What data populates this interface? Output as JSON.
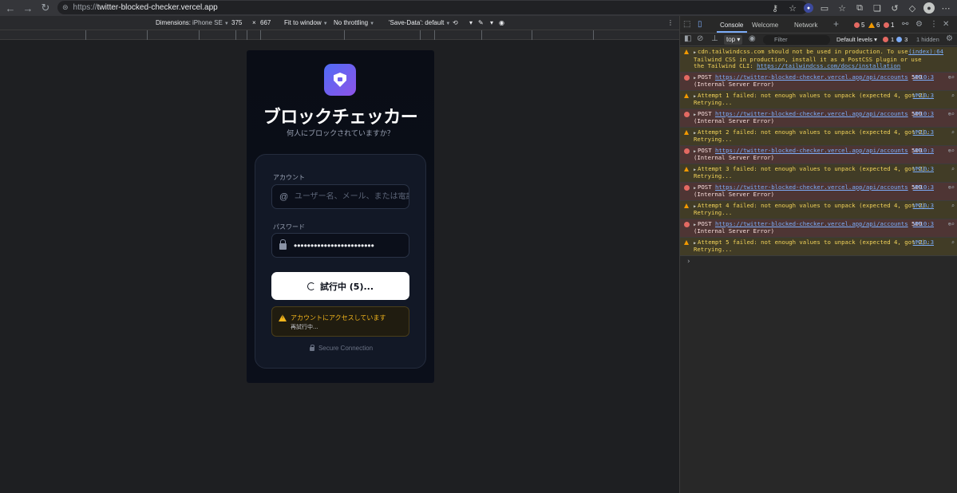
{
  "browser": {
    "url_protocol": "https://",
    "url_host": "twitter-blocked-checker.vercel.app"
  },
  "device_toolbar": {
    "dimensions_label": "Dimensions:",
    "device": "iPhone SE",
    "width": "375",
    "times": "×",
    "height": "667",
    "zoom": "Fit to window",
    "throttling": "No throttling",
    "save_data": "'Save-Data': default"
  },
  "app": {
    "title": "ブロックチェッカー",
    "subtitle": "何人にブロックされていますか？",
    "account_label": "アカウント",
    "account_placeholder": "ユーザー名、メール、または電話番号",
    "account_prefix": "@",
    "password_label": "パスワード",
    "password_value": "••••••••••••••••••••••••",
    "submit_label": "試行中 (5)...",
    "alert_title": "アカウントにアクセスしています",
    "alert_sub": "再試行中...",
    "secure_text": "Secure Connection"
  },
  "devtools": {
    "tabs": [
      "Console",
      "Welcome",
      "Network"
    ],
    "error_count": "5",
    "warn_count": "6",
    "error_count2": "1",
    "context": "top",
    "filter_placeholder": "Filter",
    "levels": "Default levels",
    "bottom_error_count": "1",
    "bottom_info_count": "3",
    "hidden": "1 hidden",
    "messages": [
      {
        "type": "warn",
        "text": "cdn.tailwindcss.com should not be used in production. To use Tailwind CSS in production, install it as a PostCSS plugin or use the Tailwind CLI: ",
        "link": "https://tailwindcss.com/docs/installation",
        "src": "(index):64"
      },
      {
        "type": "error",
        "prefix": "POST ",
        "link": "https://twitter-blocked-checker.vercel.app/api/accounts",
        "text": " 500 (Internal Server Error)",
        "src": "VM10:3"
      },
      {
        "type": "warn",
        "text": "Attempt 1 failed: not enough values to unpack (expected 4, got 2). Retrying...",
        "src": "VM10:3"
      },
      {
        "type": "error",
        "prefix": "POST ",
        "link": "https://twitter-blocked-checker.vercel.app/api/accounts",
        "text": " 500 (Internal Server Error)",
        "src": "VM10:3"
      },
      {
        "type": "warn",
        "text": "Attempt 2 failed: not enough values to unpack (expected 4, got 2). Retrying...",
        "src": "VM10:3"
      },
      {
        "type": "error",
        "prefix": "POST ",
        "link": "https://twitter-blocked-checker.vercel.app/api/accounts",
        "text": " 500 (Internal Server Error)",
        "src": "VM10:3"
      },
      {
        "type": "warn",
        "text": "Attempt 3 failed: not enough values to unpack (expected 4, got 2). Retrying...",
        "src": "VM10:3"
      },
      {
        "type": "error",
        "prefix": "POST ",
        "link": "https://twitter-blocked-checker.vercel.app/api/accounts",
        "text": " 500 (Internal Server Error)",
        "src": "VM10:3"
      },
      {
        "type": "warn",
        "text": "Attempt 4 failed: not enough values to unpack (expected 4, got 2). Retrying...",
        "src": "VM10:3"
      },
      {
        "type": "error",
        "prefix": "POST ",
        "link": "https://twitter-blocked-checker.vercel.app/api/accounts",
        "text": " 500 (Internal Server Error)",
        "src": "VM10:3"
      },
      {
        "type": "warn",
        "text": "Attempt 5 failed: not enough values to unpack (expected 4, got 2). Retrying...",
        "src": "VM10:3"
      }
    ],
    "prompt": "›"
  },
  "colors": {
    "accent": "#7cacf8",
    "warn": "#f2b51c",
    "error": "#e46962",
    "logo_start": "#4f6cf5",
    "logo_end": "#8e53e8"
  }
}
